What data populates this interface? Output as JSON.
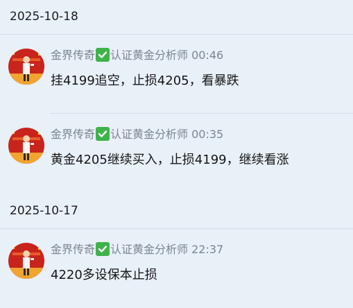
{
  "groups": [
    {
      "date": "2025-10-18",
      "messages": [
        {
          "sender": "金界传奇",
          "badge": "认证黄金分析师",
          "time": "00:46",
          "text": "挂4199追空，止损4205，看暴跌"
        },
        {
          "sender": "金界传奇",
          "badge": "认证黄金分析师",
          "time": "00:35",
          "text": "黄金4205继续买入，止损4199，继续看涨"
        }
      ]
    },
    {
      "date": "2025-10-17",
      "messages": [
        {
          "sender": "金界传奇",
          "badge": "认证黄金分析师",
          "time": "22:37",
          "text": "4220多设保本止损"
        }
      ]
    }
  ],
  "colors": {
    "background": "#e8f0f8",
    "meta_text": "#7b8590",
    "check_badge": "#3fb24a",
    "avatar_bg": "#c8241c"
  },
  "icons": {
    "verified": "check-mark-icon"
  }
}
